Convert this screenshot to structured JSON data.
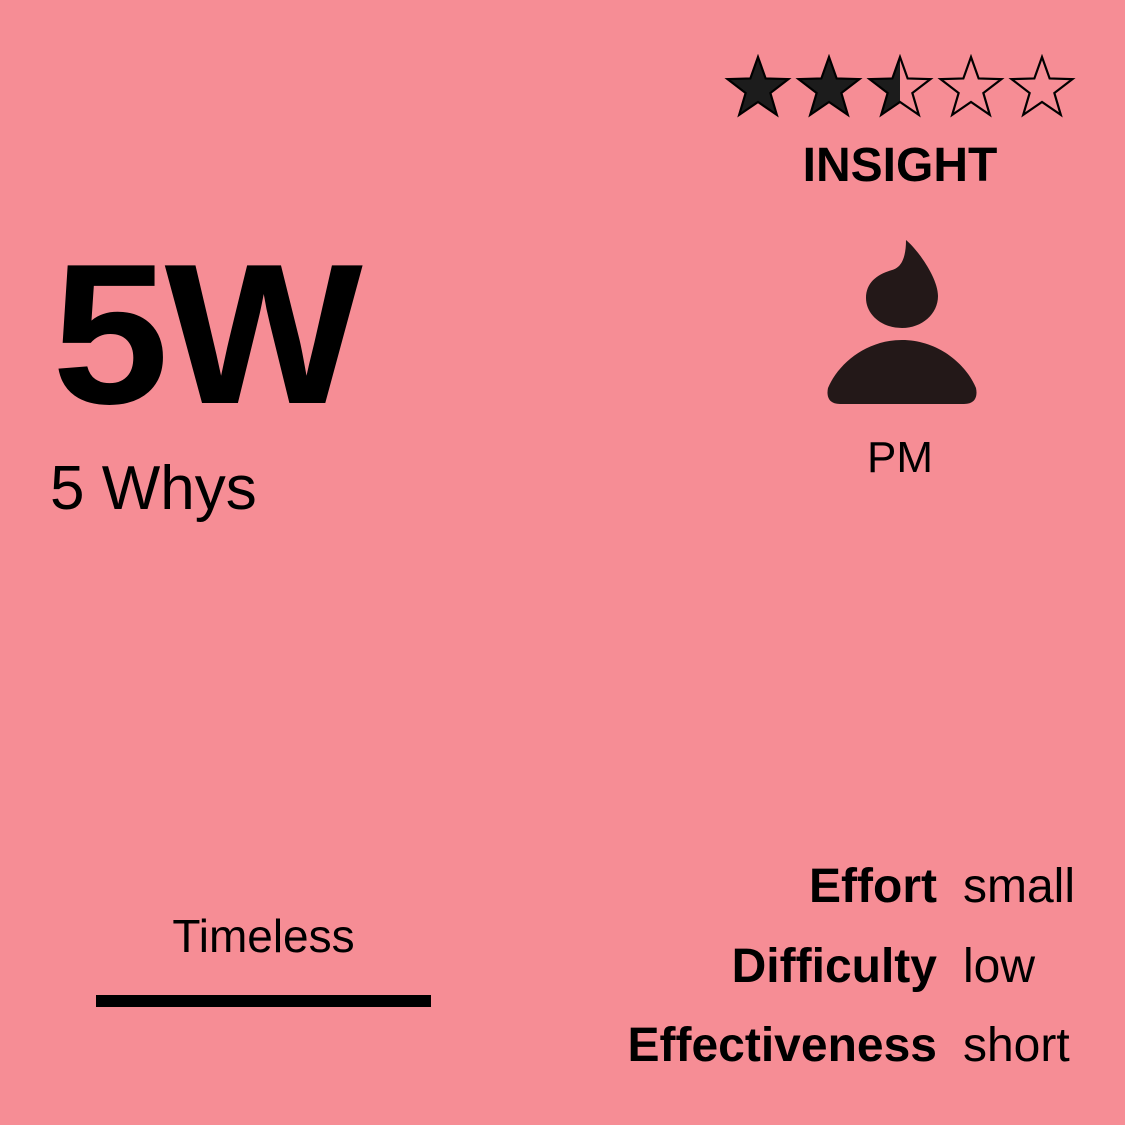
{
  "colors": {
    "background": "#f68d95",
    "ink": "#000000",
    "icon": "#231818",
    "star_fill": "#1c1c1c"
  },
  "method": {
    "abbreviation": "5W",
    "name": "5 Whys"
  },
  "rating": {
    "value": 2.5,
    "max": 5
  },
  "category": "INSIGHT",
  "role": {
    "icon": "person-icon",
    "label": "PM"
  },
  "timeframe": "Timeless",
  "metrics": [
    {
      "label": "Effort",
      "value": "small"
    },
    {
      "label": "Difficulty",
      "value": "low"
    },
    {
      "label": "Effectiveness",
      "value": "short"
    }
  ]
}
